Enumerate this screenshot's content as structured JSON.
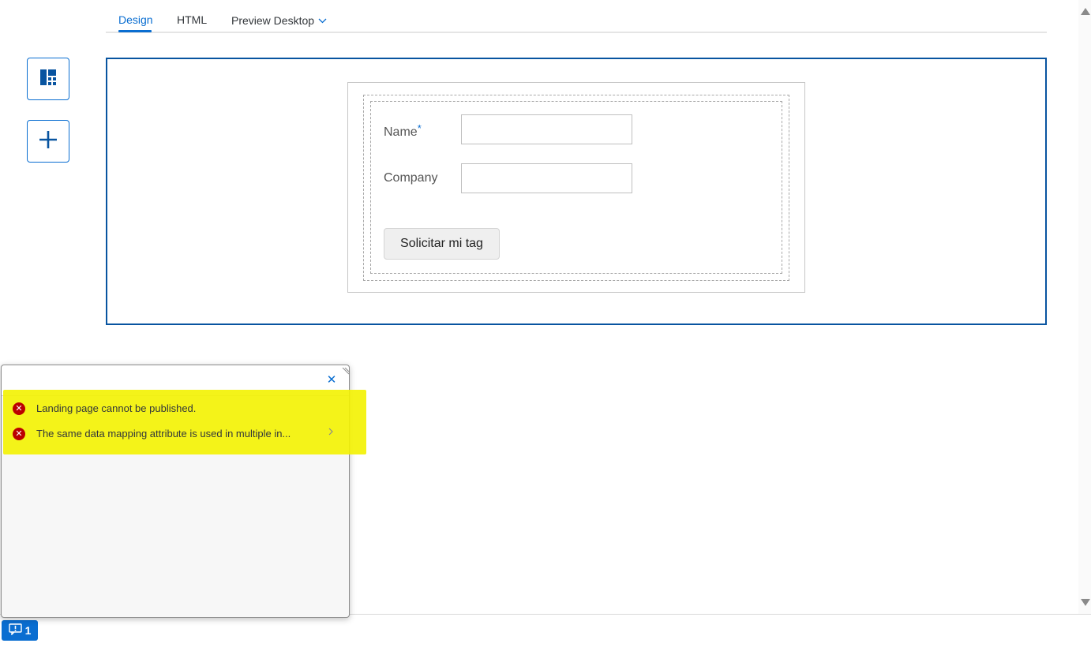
{
  "tabs": {
    "design": "Design",
    "html": "HTML",
    "preview": "Preview Desktop"
  },
  "toolbar": {
    "layout_icon": "layout-icon",
    "add_icon": "plus-icon"
  },
  "form": {
    "name_label": "Name",
    "required_mark": "*",
    "company_label": "Company",
    "name_value": "",
    "company_value": "",
    "submit_label": "Solicitar mi tag"
  },
  "popover": {
    "close_icon": "close-icon",
    "messages": [
      {
        "type": "error",
        "text": "Landing page cannot be published."
      },
      {
        "type": "error",
        "text": "The same data mapping attribute is used in multiple in..."
      }
    ]
  },
  "footer": {
    "message_count": "1",
    "message_icon": "message-popover-icon"
  },
  "colors": {
    "accent": "#0a6ed1",
    "canvas_border": "#0854a0",
    "error": "#bb0000",
    "highlight": "#f3f200"
  }
}
